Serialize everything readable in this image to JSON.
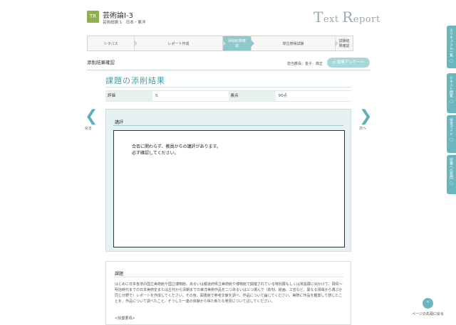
{
  "header": {
    "logo_text": "TR",
    "course_title": "芸術論I-3",
    "course_sub": "芸術総論 1　日本・東洋",
    "brand_big_t": "T",
    "brand_ext": "ext ",
    "brand_big_r": "R",
    "brand_eport": "eport"
  },
  "steps": [
    {
      "label": "シラバス",
      "active": false
    },
    {
      "label": "レポート作成",
      "active": false
    },
    {
      "label": "添削結果確認",
      "active": true
    },
    {
      "label": "単位修得試験",
      "active": false
    },
    {
      "label": "試験結果確認",
      "active": false
    }
  ],
  "breadcrumb": "添削結果確認",
  "teacher": "担当教員：金子　典正",
  "survey_button": "授業アンケート",
  "heading": "課題の添削結果",
  "score": {
    "rating_label": "評価",
    "rating_value": "S",
    "points_label": "素点",
    "points_value": "90点"
  },
  "nav": {
    "back": "戻る",
    "next": "次へ"
  },
  "comment": {
    "label": "講評",
    "line1": "合否に関わらず、教員からの講評があります。",
    "line2": "必ず確認してください。"
  },
  "task": {
    "label": "課題",
    "body": "はじめに日本各地の国立美術館や国立博物館、あるいは都道府県立美術館や博物館で開催されている特別展もしくは常設展に出かけて、飛鳥～明治時代までの日本美術史または古代から清朝までの東洋美術作品を二つあるいは三つ選んで（彫刻、絵画、工芸など、異なる領域から選ぶか同じ分野で）レポートを作成してください。その後、図書館で参考文献を調べ、作品について論じてください。実際に作品を鑑賞して感じたことを、作品について調べたこと、そうした一連の体験から得た新たな発見について記してください。",
    "more": "<授業要項>"
  },
  "side_tabs": [
    {
      "label": "カリキュラム一覧"
    },
    {
      "label": "テキスト閲覧"
    },
    {
      "label": "学習ガイド"
    },
    {
      "label": "授業への質問"
    }
  ],
  "to_top": "ページの先頭に戻る"
}
